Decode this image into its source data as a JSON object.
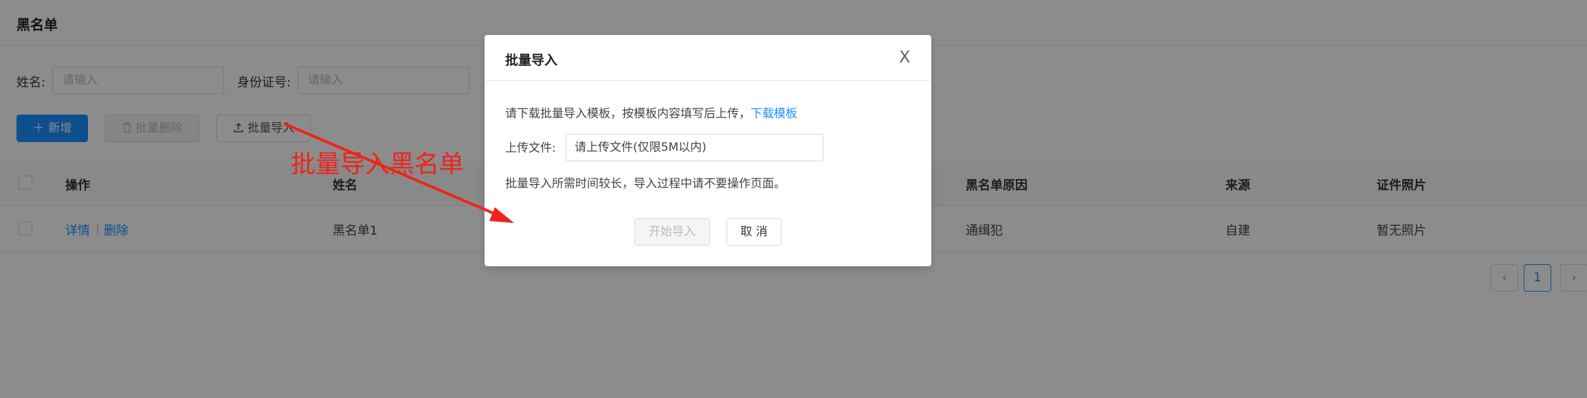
{
  "page": {
    "title": "黑名单"
  },
  "search": {
    "name_label": "姓名:",
    "name_placeholder": "请输入",
    "id_label": "身份证号:",
    "id_placeholder": "请输入"
  },
  "toolbar": {
    "add_label": "新增",
    "batch_delete_label": "批量删除",
    "batch_import_label": "批量导入"
  },
  "table": {
    "columns": [
      "操作",
      "姓名",
      "黑名单原因",
      "来源",
      "证件照片"
    ],
    "rows": [
      {
        "detail": "详情",
        "delete": "删除",
        "name": "黑名单1",
        "reason": "通缉犯",
        "source": "自建",
        "photo": "暂无照片"
      }
    ]
  },
  "pagination": {
    "prev": "‹",
    "current": "1",
    "next": "›"
  },
  "modal": {
    "title": "批量导入",
    "close": "X",
    "instruction": "请下载批量导入模板，按模板内容填写后上传，",
    "download_link": "下载模板",
    "upload_label": "上传文件:",
    "upload_placeholder": "请上传文件(仅限5M以内)",
    "note": "批量导入所需时间较长，导入过程中请不要操作页面。",
    "start_label": "开始导入",
    "cancel_label": "取 消"
  },
  "annotation": {
    "text": "批量导入黑名单"
  },
  "colors": {
    "primary": "#1890ff",
    "annotation": "#f0231c",
    "overlay": "rgba(0,0,0,0.45)"
  },
  "icons": {
    "add": "plus-icon",
    "delete": "trash-icon",
    "import": "upload-icon",
    "close": "close-icon"
  }
}
